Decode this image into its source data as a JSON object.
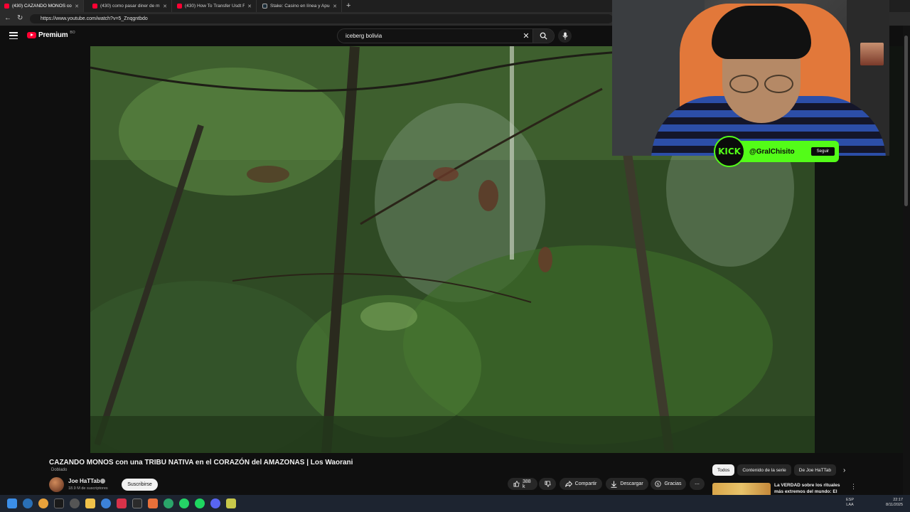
{
  "browser": {
    "tabs": [
      {
        "label": "(430) CAZANDO MONOS con",
        "favicon": "youtube-icon",
        "active": true
      },
      {
        "label": "(430) como pasar diner de mi wa",
        "favicon": "youtube-icon",
        "active": false
      },
      {
        "label": "(430) How To Transfer Usdt From",
        "favicon": "youtube-icon",
        "active": false
      },
      {
        "label": "Stake: Casino en línea y Apuestas",
        "favicon": "stake-icon",
        "active": false
      }
    ],
    "new_tab_symbol": "+",
    "url": "https://www.youtube.com/watch?v=5_Znqgntbdo"
  },
  "youtube": {
    "logo_word": "Premium",
    "region": "BO",
    "search": {
      "value": "iceberg bolivia",
      "placeholder": "Buscar"
    }
  },
  "video": {
    "title": "CAZANDO MONOS con una TRIBU NATIVA en el CORAZÓN del AMAZONAS | Los Waorani",
    "badge": "Doblado",
    "channel": "Joe HaTTab",
    "subscribers": "18.9 M de suscriptores",
    "subscribe_label": "Suscribirse",
    "likes": "388 k",
    "share_label": "Compartir",
    "download_label": "Descargar",
    "thanks_label": "Gracias"
  },
  "overlay": {
    "platform": "KICK",
    "handle": "@GralChisito",
    "follow_label": "Seguir"
  },
  "sidebar": {
    "chips": [
      "Todos",
      "Contenido de la serie",
      "De Joe HaTTab"
    ],
    "recommendation_title": "La VERDAD sobre los rituales más extremos del mundo: El"
  },
  "taskbar": {
    "lang": "ESP",
    "lang_region": "LAA",
    "time": "22:17",
    "date": "8/11/2025"
  },
  "colors": {
    "youtube_red": "#ff0033",
    "kick_green": "#53fc18",
    "background": "#0f0f0f"
  }
}
